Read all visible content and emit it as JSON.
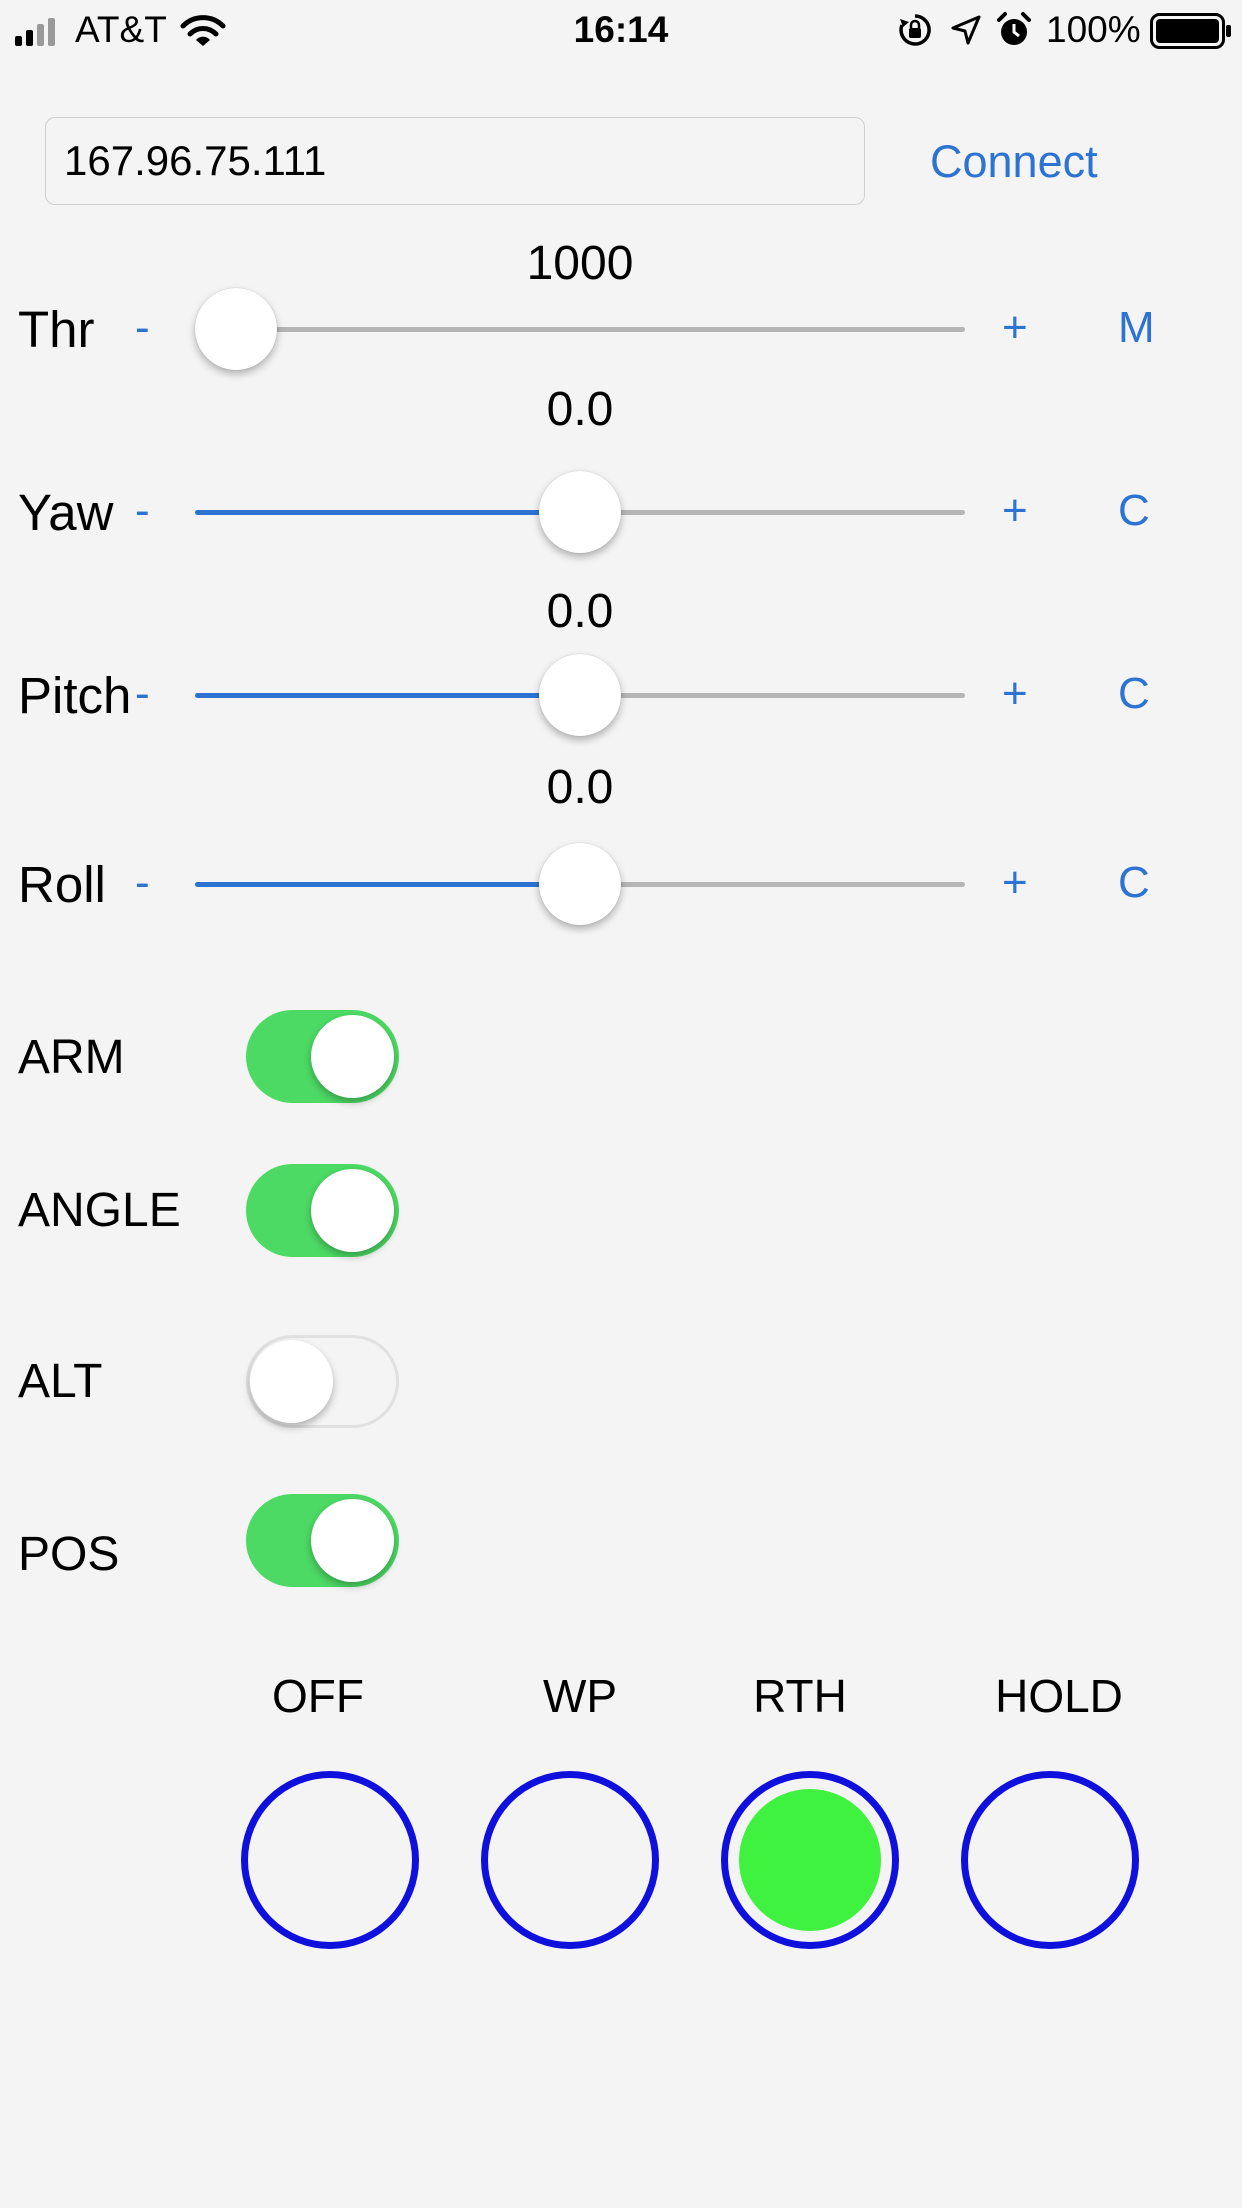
{
  "status_bar": {
    "carrier": "AT&T",
    "time": "16:14",
    "battery": "100%"
  },
  "connection": {
    "ip_value": "167.96.75.111",
    "connect_label": "Connect"
  },
  "sliders": {
    "thr": {
      "label": "Thr",
      "value": "1000",
      "minus": "-",
      "plus": "+",
      "side": "M",
      "fraction": 0.0
    },
    "yaw": {
      "label": "Yaw",
      "value": "0.0",
      "minus": "-",
      "plus": "+",
      "side": "C",
      "fraction": 0.5
    },
    "pitch": {
      "label": "Pitch",
      "value": "0.0",
      "minus": "-",
      "plus": "+",
      "side": "C",
      "fraction": 0.5
    },
    "roll": {
      "label": "Roll",
      "value": "0.0",
      "minus": "-",
      "plus": "+",
      "side": "C",
      "fraction": 0.5
    }
  },
  "switches": {
    "arm": {
      "label": "ARM",
      "on": true
    },
    "angle": {
      "label": "ANGLE",
      "on": true
    },
    "alt": {
      "label": "ALT",
      "on": false
    },
    "pos": {
      "label": "POS",
      "on": true
    }
  },
  "modes": {
    "items": [
      "OFF",
      "WP",
      "RTH",
      "HOLD"
    ],
    "selected": "RTH"
  },
  "colors": {
    "accent": "#2d73d2",
    "switch_on": "#4cd964",
    "ring": "#1010dd",
    "selected_fill": "#3ff23f"
  }
}
